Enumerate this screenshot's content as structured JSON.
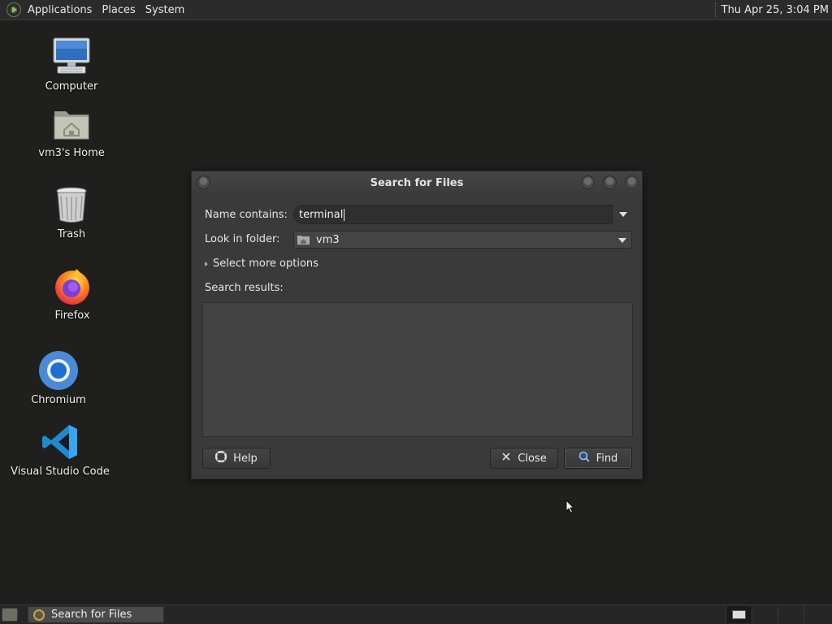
{
  "top_panel": {
    "menus": [
      "Applications",
      "Places",
      "System"
    ],
    "clock": "Thu Apr 25,  3:04 PM"
  },
  "desktop_icons": [
    {
      "label": "Computer",
      "icon": "computer-icon"
    },
    {
      "label": "vm3's Home",
      "icon": "home-folder-icon"
    },
    {
      "label": "Trash",
      "icon": "trash-icon"
    },
    {
      "label": "Firefox",
      "icon": "firefox-icon"
    },
    {
      "label": "Chromium",
      "icon": "chromium-icon"
    },
    {
      "label": "Visual Studio Code",
      "icon": "vscode-icon"
    }
  ],
  "dialog": {
    "title": "Search for Files",
    "name_label": "Name contains:",
    "name_value": "terminal",
    "folder_label": "Look in folder:",
    "folder_value": "vm3",
    "more_options": "Select more options",
    "results_label": "Search results:",
    "buttons": {
      "help": "Help",
      "close": "Close",
      "find": "Find"
    }
  },
  "taskbar": {
    "task_label": "Search for Files",
    "workspaces": 4,
    "active_workspace": 1
  },
  "colors": {
    "desktop_bg": "#1f201d",
    "panel_bg": "#2b2b2b",
    "dialog_bg": "#3a3a3a"
  }
}
